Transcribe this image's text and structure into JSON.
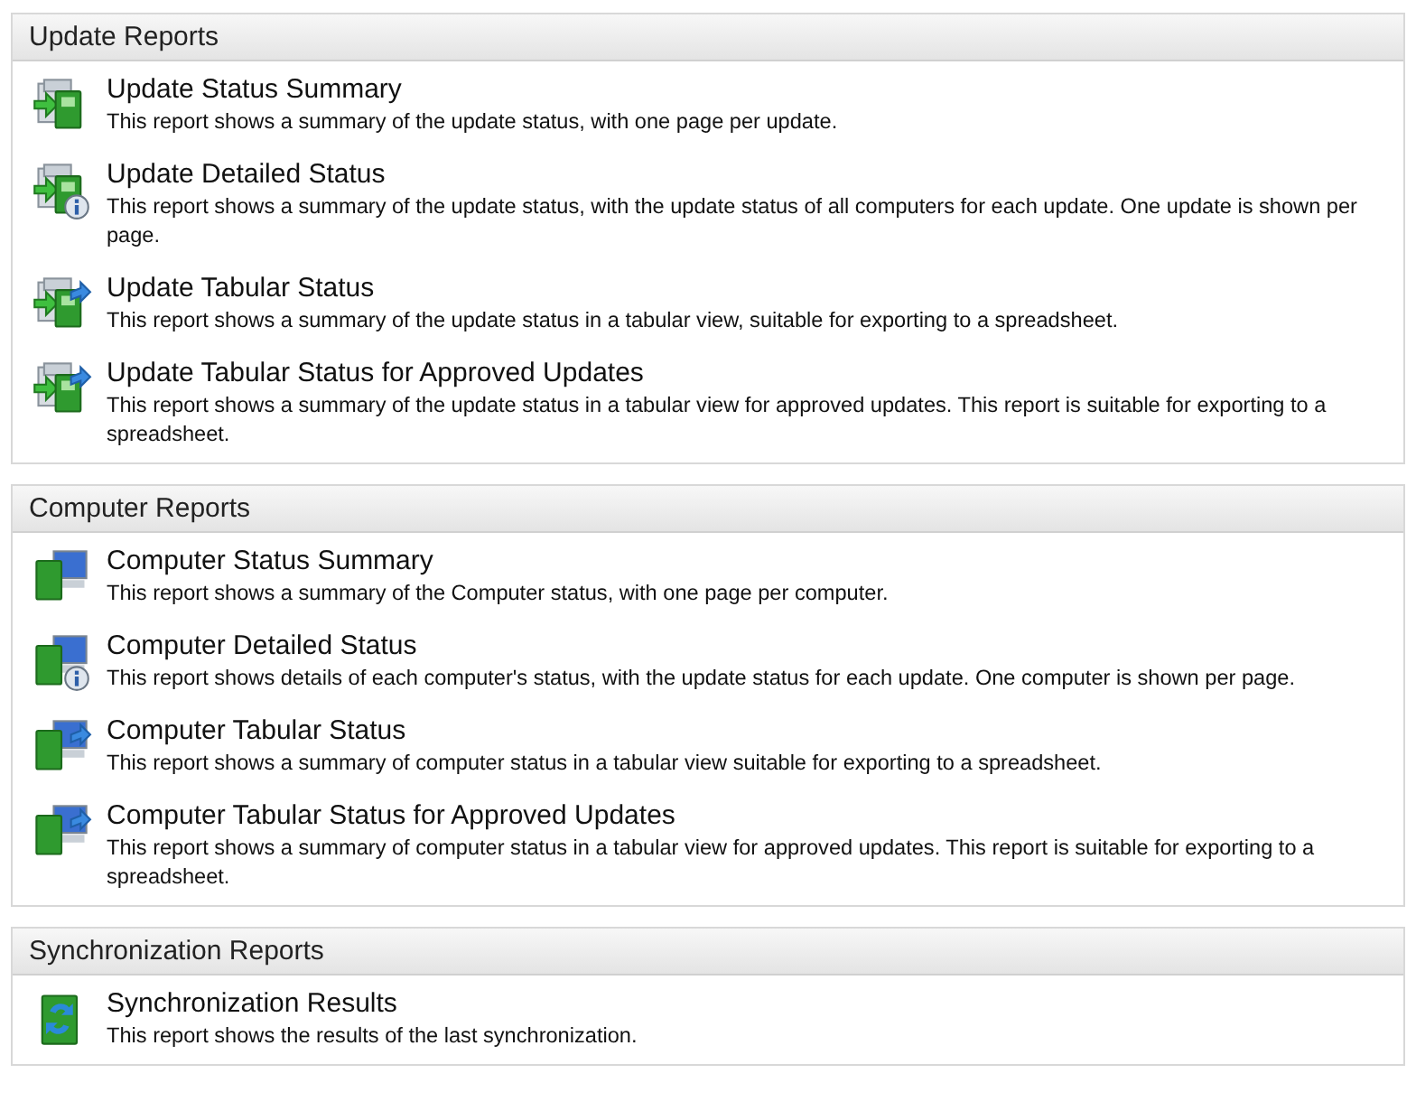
{
  "sections": [
    {
      "title": "Update Reports",
      "items": [
        {
          "kind": "update",
          "title": "Update Status Summary",
          "description": "This report shows a summary of the update status, with one page per update."
        },
        {
          "kind": "updateinfo",
          "title": "Update Detailed Status",
          "description": "This report shows a summary of the update status, with the update status of all computers for each update. One update is shown per page."
        },
        {
          "kind": "updatetable",
          "title": "Update Tabular Status",
          "description": "This report shows a summary of the update status in a tabular view, suitable for exporting to a spreadsheet."
        },
        {
          "kind": "updatetable",
          "title": "Update Tabular Status for Approved Updates",
          "description": "This report shows a summary of the update status in a tabular view for approved updates. This report is suitable for exporting to a spreadsheet."
        }
      ]
    },
    {
      "title": "Computer Reports",
      "items": [
        {
          "kind": "computer",
          "title": "Computer Status Summary",
          "description": "This report shows a summary of the Computer status, with one page per computer."
        },
        {
          "kind": "computerinfo",
          "title": "Computer Detailed Status",
          "description": "This report shows details of each computer's status, with the update status for each update. One computer is shown per page."
        },
        {
          "kind": "computertable",
          "title": "Computer Tabular Status",
          "description": "This report shows a summary of computer status in a tabular view suitable for exporting to a spreadsheet."
        },
        {
          "kind": "computertable",
          "title": "Computer Tabular Status for Approved Updates",
          "description": "This report shows a summary of computer status in a tabular view for approved updates. This report is suitable for exporting to a spreadsheet."
        }
      ]
    },
    {
      "title": "Synchronization Reports",
      "items": [
        {
          "kind": "sync",
          "title": "Synchronization Results",
          "description": "This report shows the results of the last synchronization."
        }
      ]
    }
  ]
}
